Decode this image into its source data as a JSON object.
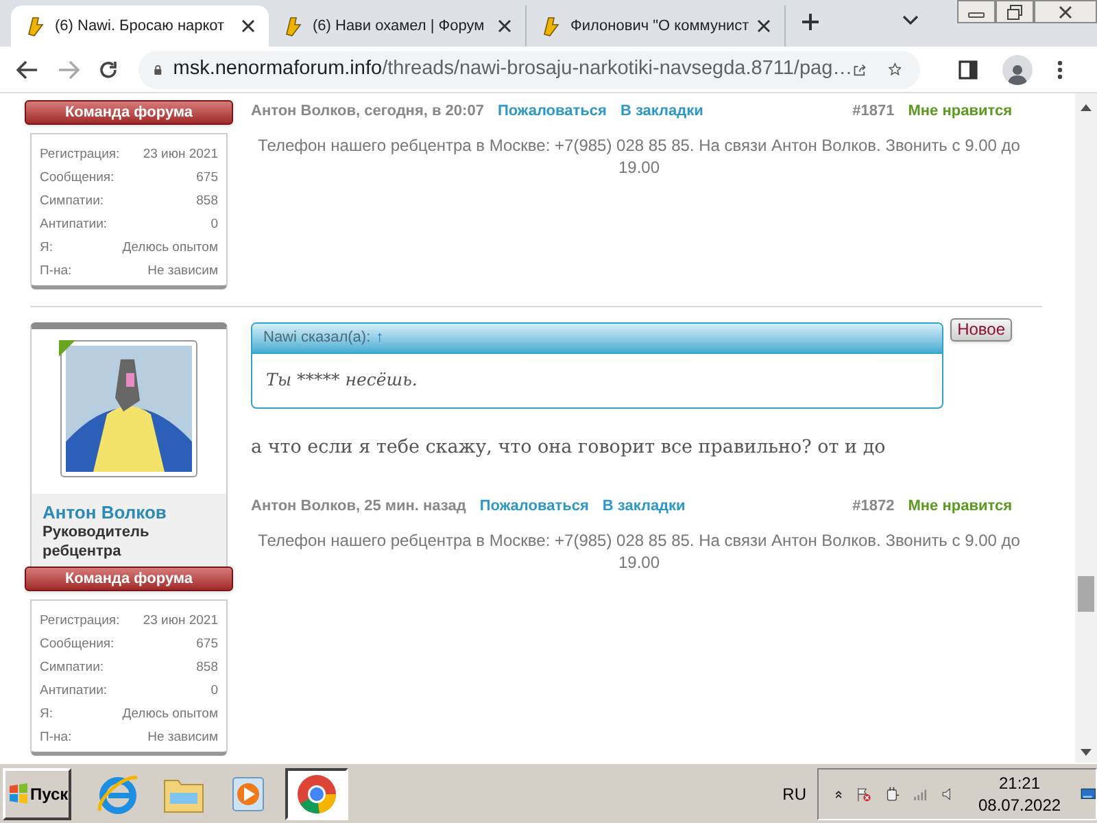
{
  "browser": {
    "tabs": [
      {
        "title": "(6) Nawi. Бросаю наркот",
        "selected": true
      },
      {
        "title": "(6) Нави охамел | Форум",
        "selected": false
      },
      {
        "title": "Филонович \"О коммунист",
        "selected": false
      }
    ],
    "address": {
      "host": "msk.nenormaforum.info",
      "path": "/threads/nawi-brosaju-narkotiki-navsegda.8711/pag…"
    }
  },
  "posts": [
    {
      "author": {
        "badge": "Команда форума",
        "stats": [
          {
            "label": "Регистрация:",
            "value": "23 июн 2021"
          },
          {
            "label": "Сообщения:",
            "value": "675"
          },
          {
            "label": "Симпатии:",
            "value": "858"
          },
          {
            "label": "Антипатии:",
            "value": "0"
          },
          {
            "label": "Я:",
            "value": "Делюсь опытом"
          },
          {
            "label": "П-на:",
            "value": "Не зависим"
          }
        ]
      },
      "meta": {
        "byline": "Антон Волков, сегодня, в 20:07",
        "report": "Пожаловаться",
        "bookmark": "В закладки",
        "number": "#1871",
        "like": "Мне нравится"
      },
      "signature": "Телефон нашего ребцентра в Москве: +7(985) 028 85 85. На связи Антон Волков. Звонить с 9.00 до 19.00"
    },
    {
      "author": {
        "name": "Антон Волков",
        "title": "Руководитель ребцентра",
        "online": true,
        "badge": "Команда форума",
        "stats": [
          {
            "label": "Регистрация:",
            "value": "23 июн 2021"
          },
          {
            "label": "Сообщения:",
            "value": "675"
          },
          {
            "label": "Симпатии:",
            "value": "858"
          },
          {
            "label": "Антипатии:",
            "value": "0"
          },
          {
            "label": "Я:",
            "value": "Делюсь опытом"
          },
          {
            "label": "П-на:",
            "value": "Не зависим"
          }
        ]
      },
      "new_label": "Новое",
      "quote": {
        "header": "Nawi сказал(а):",
        "arrow": "↑",
        "text": "Ты ***** несёшь."
      },
      "message": "а что если я тебе скажу, что она говорит все правильно? от и до",
      "meta": {
        "byline": "Антон Волков, 25 мин. назад",
        "report": "Пожаловаться",
        "bookmark": "В закладки",
        "number": "#1872",
        "like": "Мне нравится"
      },
      "signature": "Телефон нашего ребцентра в Москве: +7(985) 028 85 85. На связи Антон Волков. Звонить с 9.00 до 19.00"
    }
  ],
  "taskbar": {
    "start": "Пуск",
    "apps": [
      {
        "kind": "ie",
        "selected": false
      },
      {
        "kind": "explorer",
        "selected": false
      },
      {
        "kind": "media",
        "selected": false
      },
      {
        "kind": "chrome",
        "selected": true
      }
    ],
    "language": "RU",
    "time": "21:21",
    "date": "08.07.2022"
  }
}
